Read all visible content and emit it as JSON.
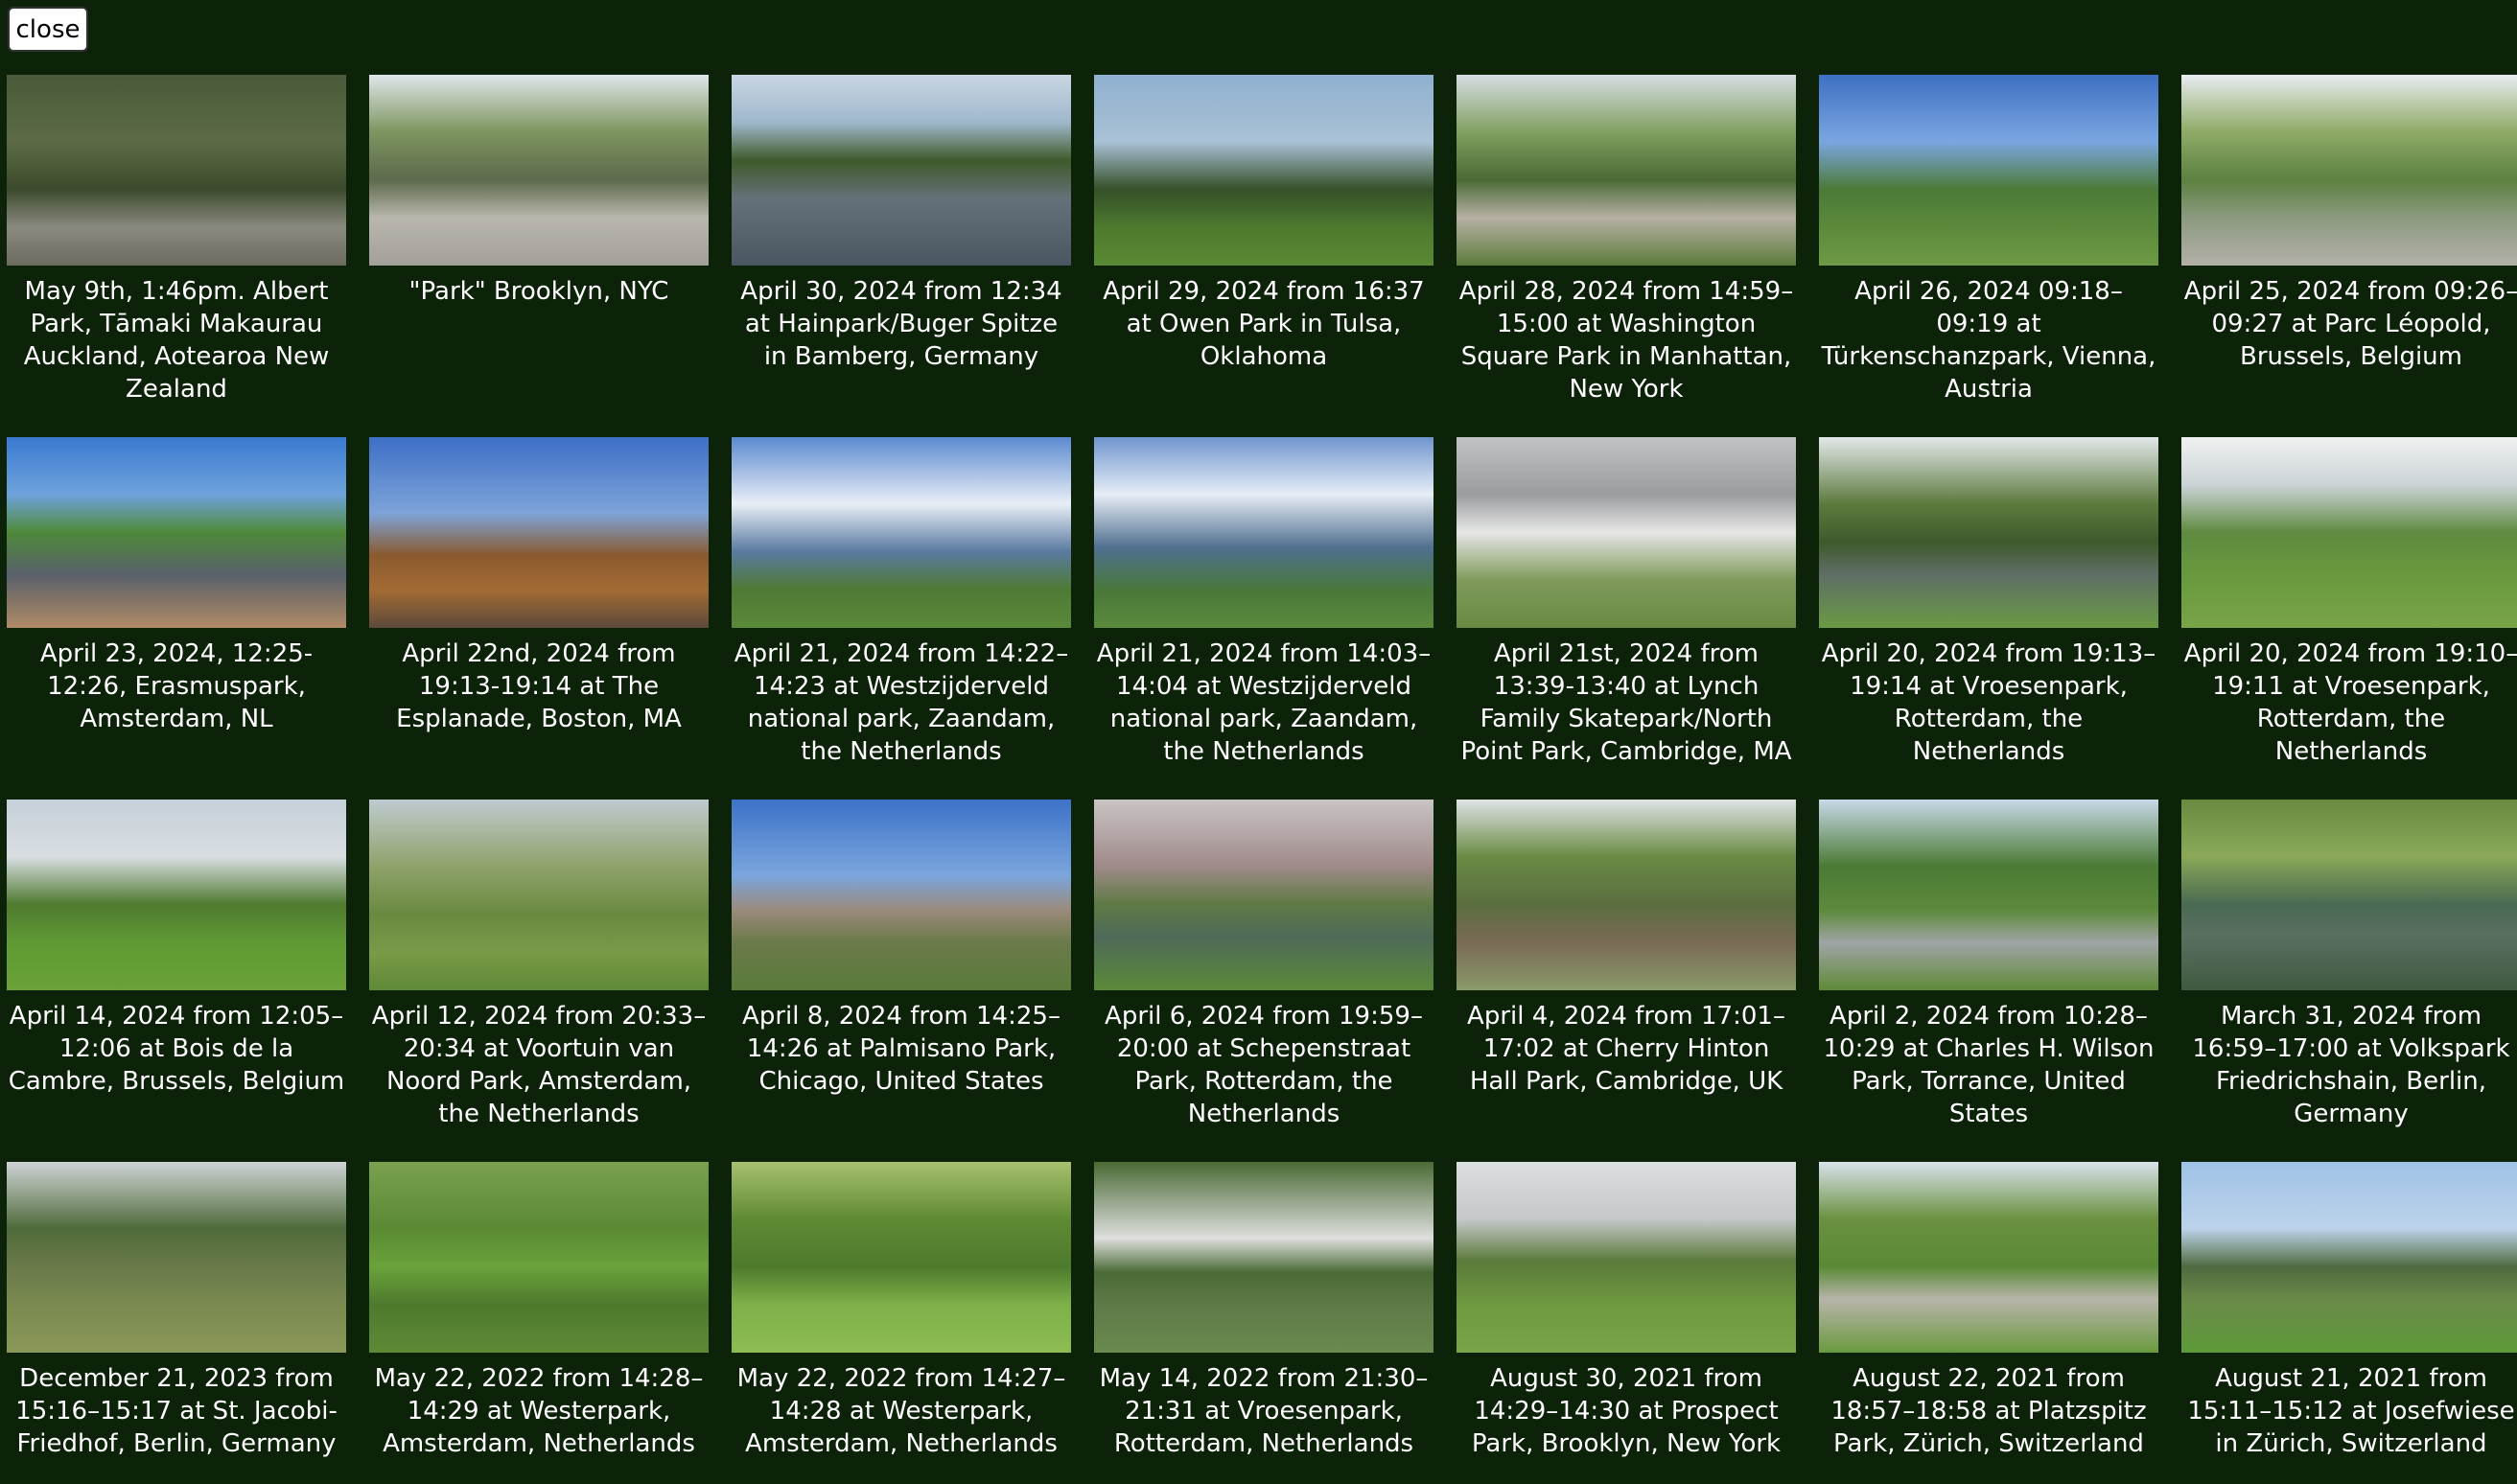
{
  "close_button": {
    "label": "close"
  },
  "photos": [
    {
      "caption": "May 9th, 1:46pm. Albert Park, Tāmaki Makaurau Auckland, Aotearoa New Zealand"
    },
    {
      "caption": "\"Park\" Brooklyn, NYC"
    },
    {
      "caption": "April 30, 2024 from 12:34 at Hainpark/Buger Spitze in Bamberg, Germany"
    },
    {
      "caption": "April 29, 2024 from 16:37 at Owen Park in Tulsa, Oklahoma"
    },
    {
      "caption": "April 28, 2024 from 14:59–15:00 at Washington Square Park in Manhattan, New York"
    },
    {
      "caption": "April 26, 2024 09:18–09:19 at Türkenschanzpark, Vienna, Austria"
    },
    {
      "caption": "April 25, 2024 from 09:26–09:27 at Parc Léopold, Brussels, Belgium"
    },
    {
      "caption": "April 23, 2024, 12:25-12:26, Erasmuspark, Amsterdam, NL"
    },
    {
      "caption": "April 22nd, 2024 from 19:13-19:14 at The Esplanade, Boston, MA"
    },
    {
      "caption": "April 21, 2024 from 14:22–14:23 at Westzijderveld national park, Zaandam, the Netherlands"
    },
    {
      "caption": "April 21, 2024 from 14:03–14:04 at Westzijderveld national park, Zaandam, the Netherlands"
    },
    {
      "caption": "April 21st, 2024 from 13:39-13:40 at Lynch Family Skatepark/North Point Park, Cambridge, MA"
    },
    {
      "caption": "April 20, 2024 from 19:13–19:14 at Vroesenpark, Rotterdam, the Netherlands"
    },
    {
      "caption": "April 20, 2024 from 19:10–19:11 at Vroesenpark, Rotterdam, the Netherlands"
    },
    {
      "caption": "April 14, 2024 from 12:05–12:06 at Bois de la Cambre, Brussels, Belgium"
    },
    {
      "caption": "April 12, 2024 from 20:33–20:34 at Voortuin van Noord Park, Amsterdam, the Netherlands"
    },
    {
      "caption": "April 8, 2024 from 14:25–14:26 at Palmisano Park, Chicago, United States"
    },
    {
      "caption": "April 6, 2024 from 19:59–20:00 at Schepenstraat Park, Rotterdam, the Netherlands"
    },
    {
      "caption": "April 4, 2024 from 17:01–17:02 at Cherry Hinton Hall Park, Cambridge, UK"
    },
    {
      "caption": "April 2, 2024 from 10:28–10:29 at Charles H. Wilson Park, Torrance, United States"
    },
    {
      "caption": "March 31, 2024 from 16:59–17:00 at Volkspark Friedrichshain, Berlin, Germany"
    },
    {
      "caption": "December 21, 2023 from 15:16–15:17 at St. Jacobi-Friedhof, Berlin, Germany"
    },
    {
      "caption": "May 22, 2022 from 14:28–14:29 at Westerpark, Amsterdam, Netherlands"
    },
    {
      "caption": "May 22, 2022 from 14:27–14:28 at Westerpark, Amsterdam, Netherlands"
    },
    {
      "caption": "May 14, 2022 from 21:30–21:31 at Vroesenpark, Rotterdam, Netherlands"
    },
    {
      "caption": "August 30, 2021 from 14:29–14:30 at Prospect Park, Brooklyn, New York"
    },
    {
      "caption": "August 22, 2021 from 18:57–18:58 at Platzspitz Park, Zürich, Switzerland"
    },
    {
      "caption": "August 21, 2021 from 15:11–15:12 at Josefwiese in Zürich, Switzerland"
    }
  ]
}
